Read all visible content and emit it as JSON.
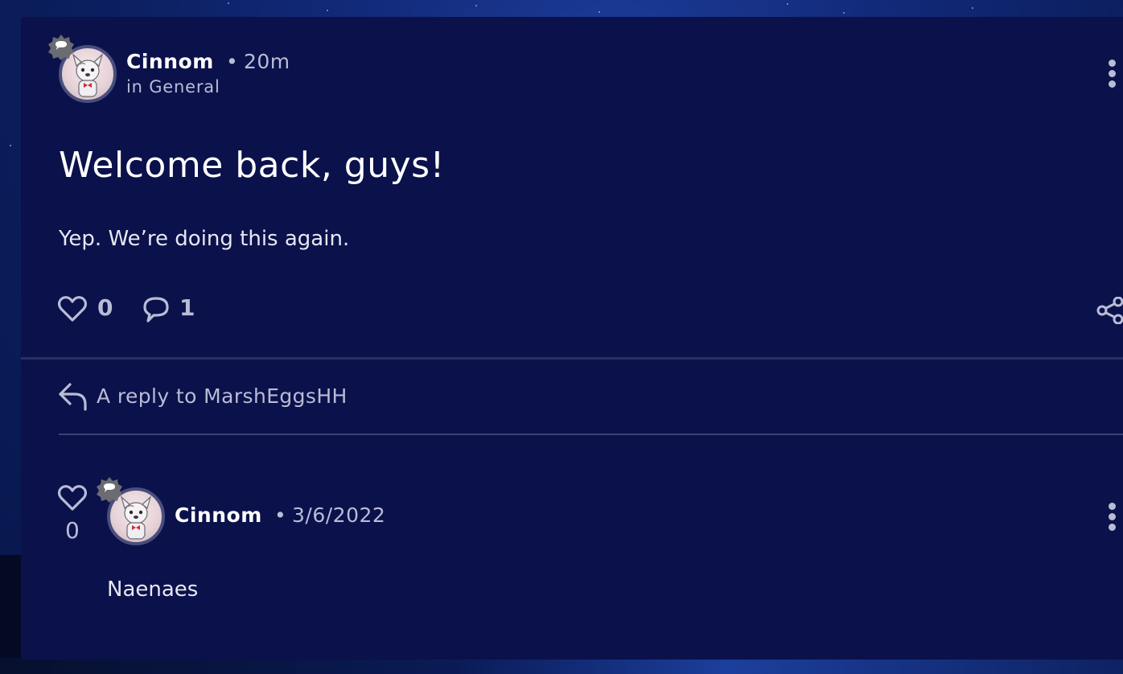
{
  "post": {
    "author": "Cinnom",
    "separator": "•",
    "time": "20m",
    "location": "in General",
    "title": "Welcome back, guys!",
    "body": "Yep. We’re doing this again.",
    "likes": "0",
    "comments": "1",
    "icons": {
      "badge": "chat-bubble-badge-icon",
      "like": "heart-icon",
      "comment": "comment-bubble-icon",
      "share": "share-icon",
      "menu": "more-vertical-icon"
    }
  },
  "reply": {
    "reply_to_label": "A reply to MarshEggsHH",
    "likes": "0",
    "author": "Cinnom",
    "separator": "•",
    "date": "3/6/2022",
    "body": "Naenaes",
    "icons": {
      "reply_arrow": "reply-arrow-icon",
      "like": "heart-icon",
      "badge": "chat-bubble-badge-icon",
      "menu": "more-vertical-icon"
    }
  },
  "colors": {
    "card_bg": "#0b114a",
    "text_primary": "#ffffff",
    "text_secondary": "#b9bcd6",
    "page_bg": "#122a7a"
  }
}
